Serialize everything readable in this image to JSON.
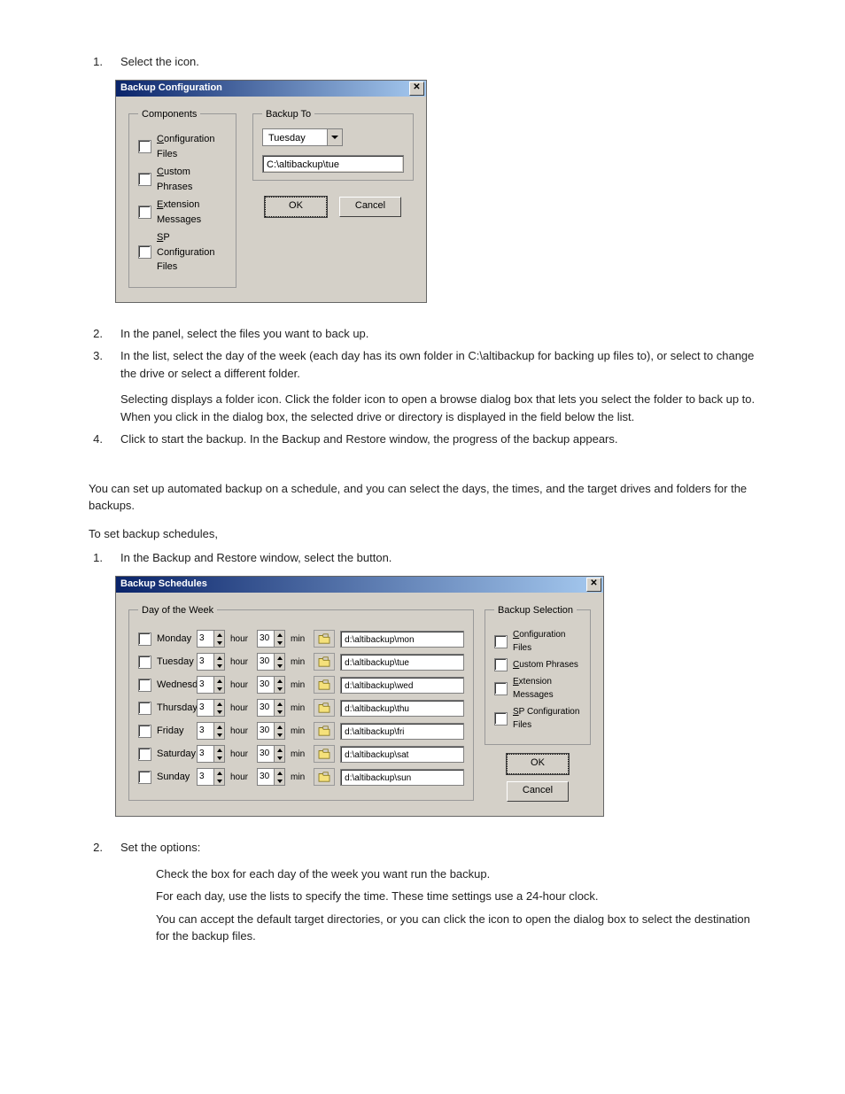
{
  "step1": {
    "num": "1.",
    "text": "Select the            icon."
  },
  "dlg1": {
    "title": "Backup Configuration",
    "components_legend": "Components",
    "components": [
      "Configuration Files",
      "Custom Phrases",
      "Extension Messages",
      "SP Configuration Files"
    ],
    "backupto_legend": "Backup To",
    "day_value": "Tuesday",
    "path_value": "C:\\altibackup\\tue",
    "ok": "OK",
    "cancel": "Cancel"
  },
  "step2": {
    "num": "2.",
    "text": "In the                  panel, select the files you want to back up."
  },
  "step3": {
    "num": "3.",
    "text1": "In the              list, select the day of the week (each day has its own folder in C:\\altibackup for backing up files to), or select               to change the drive or select a different folder.",
    "text2": "Selecting               displays a folder icon. Click the folder icon to open a browse dialog box that lets you select the folder to back up to. When you click       in the dialog box, the selected drive or directory is displayed in the field below the                list."
  },
  "step4": {
    "num": "4.",
    "text": "Click       to start the backup. In the Backup and Restore window, the progress of the backup appears."
  },
  "intro2a": "You can set up automated backup on a schedule, and you can select the days, the times, and the target drives and folders for the backups.",
  "intro2b": "To set backup schedules,",
  "step2_1": {
    "num": "1.",
    "text": "In the Backup and Restore window, select the               button."
  },
  "dlg2": {
    "title": "Backup Schedules",
    "dow_legend": "Day of the Week",
    "sel_legend": "Backup Selection",
    "hour_label": "hour",
    "min_label": "min",
    "days": [
      {
        "name": "Monday",
        "h": "3",
        "m": "30",
        "path": "d:\\altibackup\\mon"
      },
      {
        "name": "Tuesday",
        "h": "3",
        "m": "30",
        "path": "d:\\altibackup\\tue"
      },
      {
        "name": "Wednesday",
        "h": "3",
        "m": "30",
        "path": "d:\\altibackup\\wed"
      },
      {
        "name": "Thursday",
        "h": "3",
        "m": "30",
        "path": "d:\\altibackup\\thu"
      },
      {
        "name": "Friday",
        "h": "3",
        "m": "30",
        "path": "d:\\altibackup\\fri"
      },
      {
        "name": "Saturday",
        "h": "3",
        "m": "30",
        "path": "d:\\altibackup\\sat"
      },
      {
        "name": "Sunday",
        "h": "3",
        "m": "30",
        "path": "d:\\altibackup\\sun"
      }
    ],
    "selection": [
      "Configuration Files",
      "Custom Phrases",
      "Extension Messages",
      "SP Configuration Files"
    ],
    "ok": "OK",
    "cancel": "Cancel"
  },
  "step2_2": {
    "num": "2.",
    "text": "Set the options:",
    "b1": "Check the box for each day of the week you want run the backup.",
    "b2": "For each day, use the lists to specify the time. These time settings use a 24-hour clock.",
    "b3": "You can accept the default target directories, or you can click the           icon to open the dialog box to select the destination for the backup files."
  }
}
